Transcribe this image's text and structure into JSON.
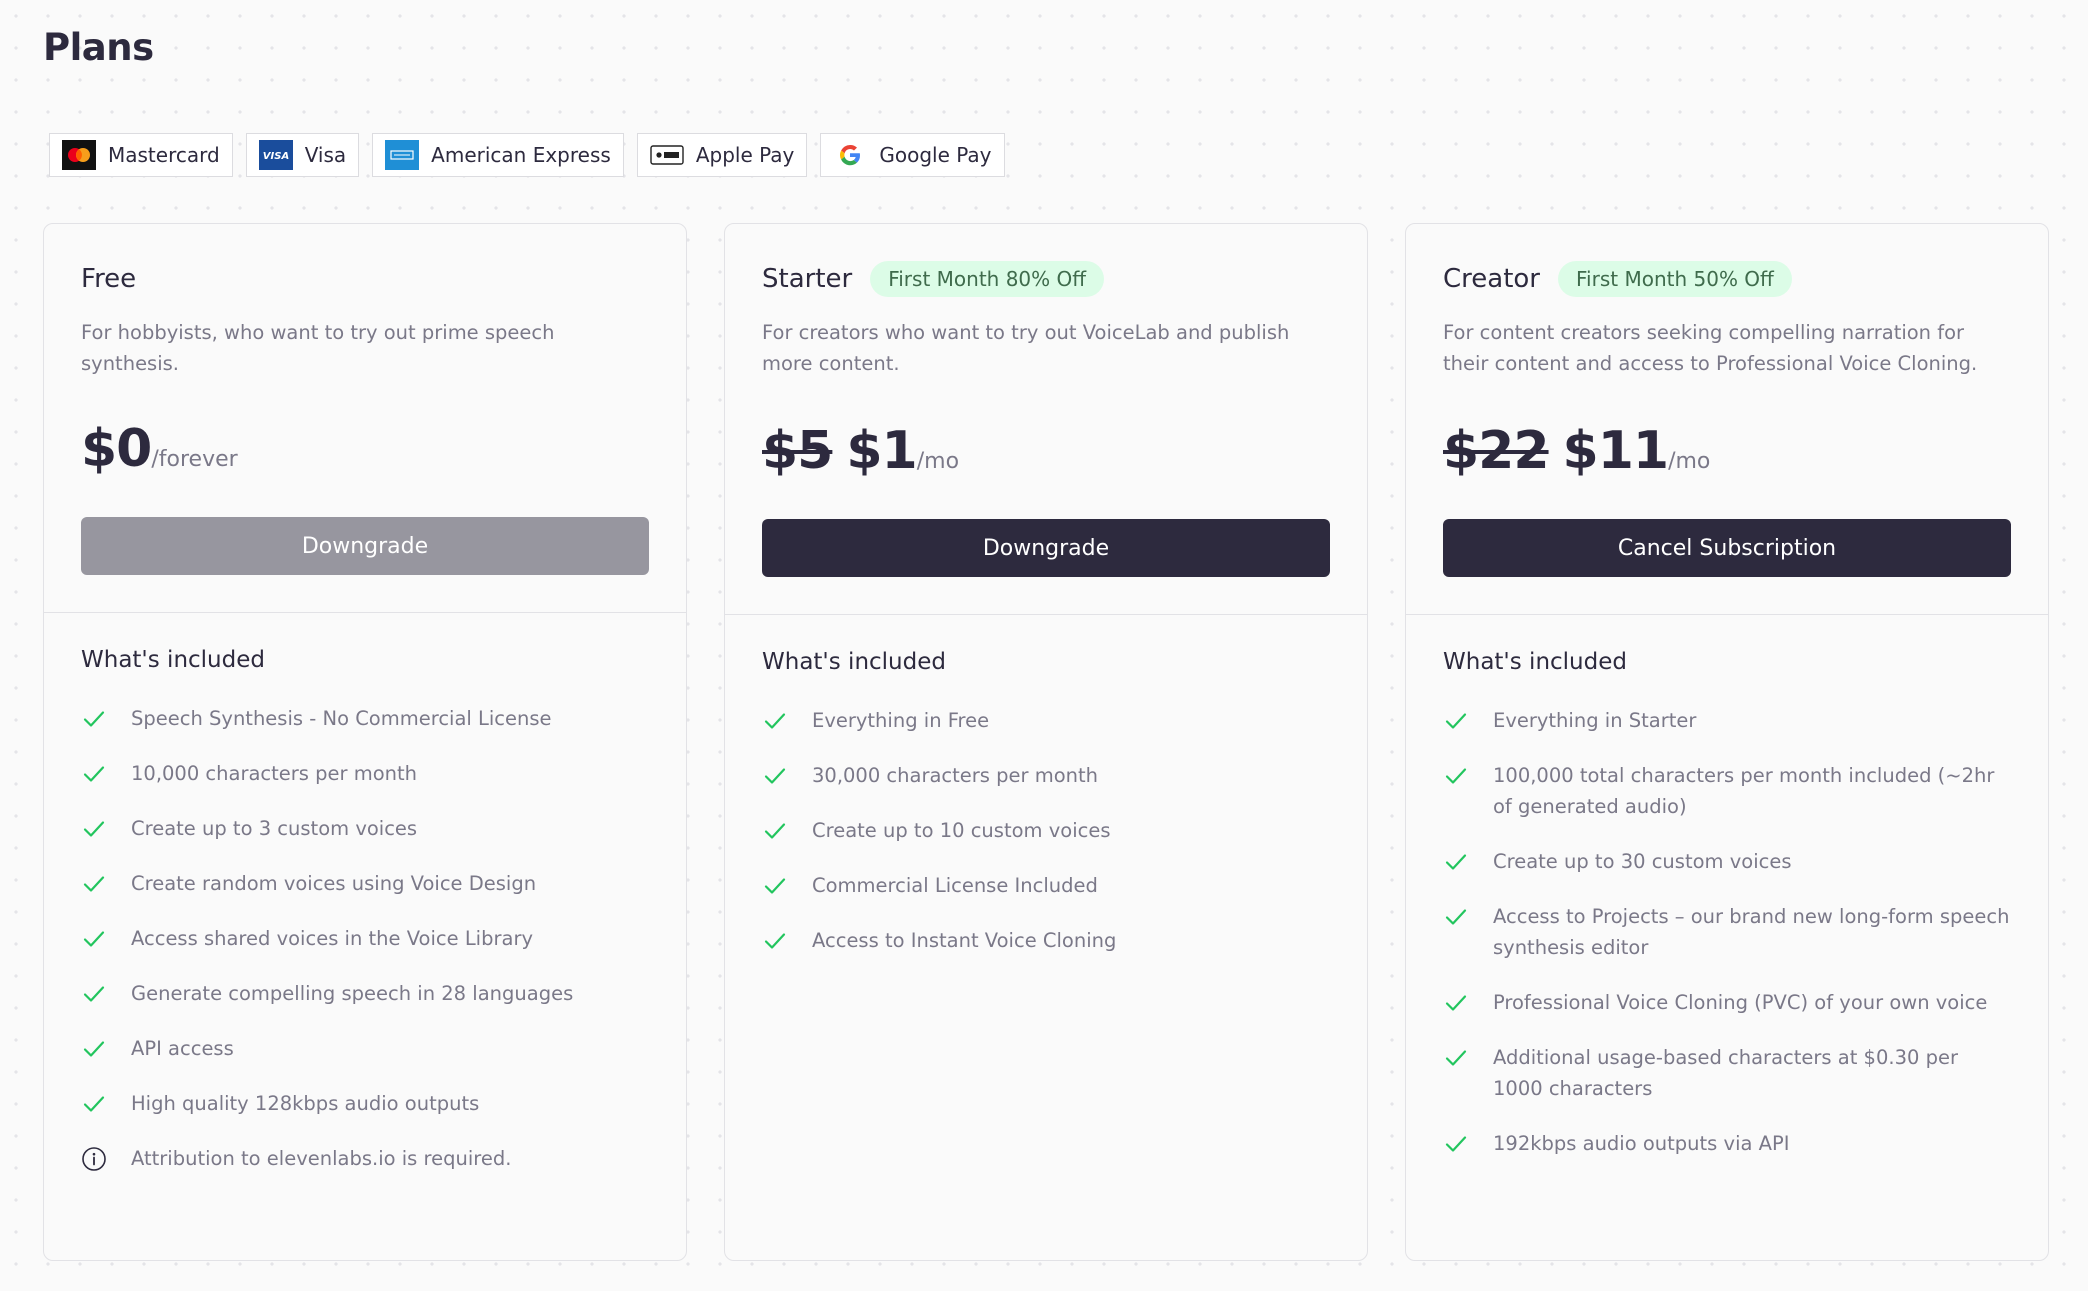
{
  "page": {
    "title": "Plans"
  },
  "payment_methods": [
    {
      "label": "Mastercard",
      "icon": "mastercard-icon"
    },
    {
      "label": "Visa",
      "icon": "visa-icon"
    },
    {
      "label": "American Express",
      "icon": "amex-icon"
    },
    {
      "label": "Apple Pay",
      "icon": "apple-pay-icon"
    },
    {
      "label": "Google Pay",
      "icon": "google-pay-icon"
    }
  ],
  "plans": [
    {
      "name": "Free",
      "badge": "",
      "description": "For hobbyists, who want to try out prime speech synthesis.",
      "price_old": "",
      "price": "$0",
      "price_unit": "/forever",
      "cta_label": "Downgrade",
      "cta_disabled": true,
      "included_title": "What's included",
      "features": [
        {
          "text": "Speech Synthesis - No Commercial License",
          "icon": "check-icon"
        },
        {
          "text": "10,000 characters per month",
          "icon": "check-icon"
        },
        {
          "text": "Create up to 3 custom voices",
          "icon": "check-icon"
        },
        {
          "text": "Create random voices using Voice Design",
          "icon": "check-icon"
        },
        {
          "text": "Access shared voices in the Voice Library",
          "icon": "check-icon"
        },
        {
          "text": "Generate compelling speech in 28 languages",
          "icon": "check-icon"
        },
        {
          "text": "API access",
          "icon": "check-icon"
        },
        {
          "text": "High quality 128kbps audio outputs",
          "icon": "check-icon"
        },
        {
          "text": "Attribution to elevenlabs.io is required.",
          "icon": "info-icon"
        }
      ]
    },
    {
      "name": "Starter",
      "badge": "First Month 80% Off",
      "description": "For creators who want to try out VoiceLab and publish more content.",
      "price_old": "$5",
      "price": "$1",
      "price_unit": "/mo",
      "cta_label": "Downgrade",
      "cta_disabled": false,
      "included_title": "What's included",
      "features": [
        {
          "text": "Everything in Free",
          "icon": "check-icon"
        },
        {
          "text": "30,000 characters per month",
          "icon": "check-icon"
        },
        {
          "text": "Create up to 10 custom voices",
          "icon": "check-icon"
        },
        {
          "text": "Commercial License Included",
          "icon": "check-icon"
        },
        {
          "text": "Access to Instant Voice Cloning",
          "icon": "check-icon"
        }
      ]
    },
    {
      "name": "Creator",
      "badge": "First Month 50% Off",
      "description": "For content creators seeking compelling narration for their content and access to Professional Voice Cloning.",
      "price_old": "$22",
      "price": "$11",
      "price_unit": "/mo",
      "cta_label": "Cancel Subscription",
      "cta_disabled": false,
      "included_title": "What's included",
      "features": [
        {
          "text": "Everything in Starter",
          "icon": "check-icon"
        },
        {
          "text": "100,000 total characters per month included (~2hr of generated audio)",
          "icon": "check-icon"
        },
        {
          "text": "Create up to 30 custom voices",
          "icon": "check-icon"
        },
        {
          "text": "Access to Projects – our brand new long-form speech synthesis editor",
          "icon": "check-icon"
        },
        {
          "text": "Professional Voice Cloning (PVC) of your own voice",
          "icon": "check-icon"
        },
        {
          "text": "Additional usage-based characters at $0.30 per 1000 characters",
          "icon": "check-icon"
        },
        {
          "text": "192kbps audio outputs via API",
          "icon": "check-icon"
        }
      ]
    }
  ],
  "colors": {
    "primary": "#2d2a3e",
    "disabled_button": "#97969f",
    "check": "#22c55e",
    "badge_bg": "#dcfce7",
    "muted_text": "#7a7888"
  }
}
